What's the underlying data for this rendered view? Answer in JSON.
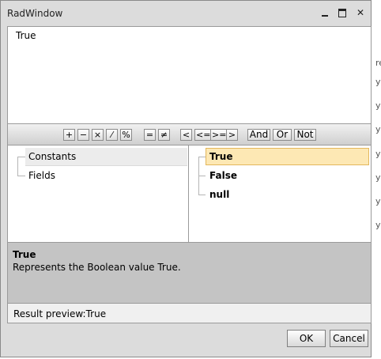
{
  "window": {
    "title": "RadWindow"
  },
  "editor": {
    "expression": "True"
  },
  "toolbar": {
    "operators": [
      "+",
      "−",
      "×",
      "⁄",
      "%",
      "=",
      "≠",
      "<",
      "<=",
      ">=",
      ">"
    ],
    "keywords": [
      "And",
      "Or",
      "Not"
    ]
  },
  "categories": {
    "items": [
      "Constants",
      "Fields"
    ],
    "selected": "Constants"
  },
  "values": {
    "items": [
      "True",
      "False",
      "null"
    ],
    "selected": "True"
  },
  "description": {
    "title": "True",
    "text": "Represents the Boolean value True."
  },
  "preview": {
    "label": "Result preview:",
    "value": "True"
  },
  "buttons": {
    "ok": "OK",
    "cancel": "Cancel"
  },
  "background_fragments": [
    "re",
    "y",
    "y",
    "y",
    "y",
    "y",
    "y",
    "y"
  ]
}
